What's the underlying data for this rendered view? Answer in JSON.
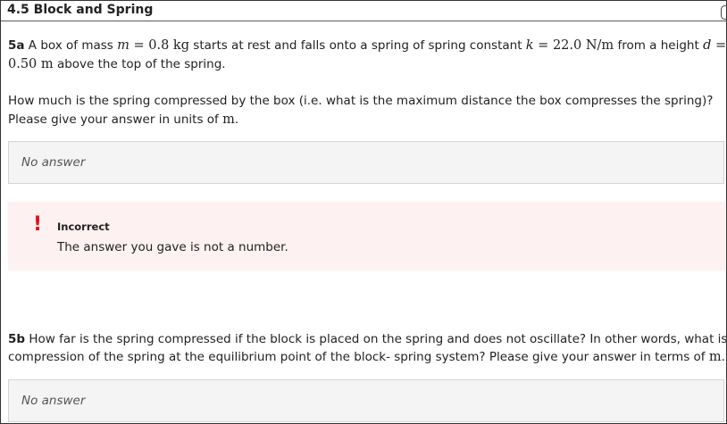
{
  "section": {
    "title": "4.5 Block and Spring"
  },
  "q5a": {
    "label": "5a",
    "line1_pre": " A box of mass ",
    "mass_expr": "0.8 kg",
    "line1_mid": " starts at rest and falls onto a spring of spring constant ",
    "k_expr": "22.0 N/m",
    "line1_post": " from a height ",
    "d_expr": "0.50 m",
    "line2_post": " above the top of the spring.",
    "prompt_line1": "How much is the spring compressed by the box (i.e. what is the maximum distance the box compresses the spring)?",
    "prompt_line2_pre": "Please give your answer in units of ",
    "unit": "m",
    "prompt_line2_post": "."
  },
  "answer_5a": {
    "value": "No answer"
  },
  "feedback": {
    "icon": "!",
    "icon_name": "exclamation-icon",
    "title": "Incorrect",
    "message": "The answer you gave is not a number."
  },
  "q5b": {
    "label": "5b",
    "line1": " How far is the spring compressed if the block is placed on the spring and does not oscillate? In other words, what is the",
    "line2_pre": "compression of the spring at the equilibrium point of the block- spring system? Please give your answer in terms of ",
    "unit": "m",
    "line2_post": "."
  },
  "answer_5b": {
    "value": "No answer"
  }
}
